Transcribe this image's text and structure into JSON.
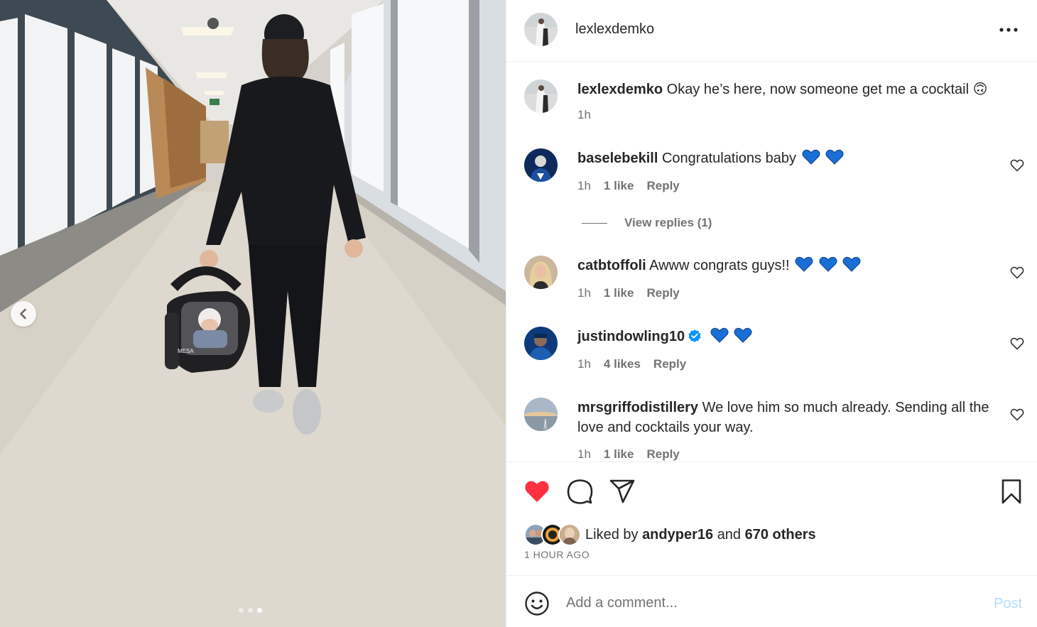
{
  "post": {
    "author": "lexlexdemko",
    "more_icon": "more-horizontal-icon"
  },
  "caption": {
    "username": "lexlexdemko",
    "text": "Okay he’s here, now someone get me a cocktail",
    "emoji": "🙃",
    "time": "1h"
  },
  "comments": [
    {
      "username": "baselebekill",
      "text": "Congratulations baby",
      "hearts": 2,
      "time": "1h",
      "likes": "1 like",
      "reply": "Reply",
      "verified": false
    },
    {
      "username": "catbtoffoli",
      "text": "Awww congrats guys!!",
      "hearts": 3,
      "time": "1h",
      "likes": "1 like",
      "reply": "Reply",
      "verified": false
    },
    {
      "username": "justindowling10",
      "text": "",
      "hearts": 2,
      "time": "1h",
      "likes": "4 likes",
      "reply": "Reply",
      "verified": true
    },
    {
      "username": "mrsgriffodistillery",
      "text": "We love him so much already. Sending all the love and cocktails your way.",
      "hearts": 0,
      "time": "1h",
      "likes": "1 like",
      "reply": "Reply",
      "verified": false
    }
  ],
  "view_replies": "View replies (1)",
  "likes": {
    "prefix": "Liked by",
    "user": "andyper16",
    "joiner": "and",
    "others": "670 others"
  },
  "time_ago": "1 HOUR AGO",
  "comment_box": {
    "placeholder": "Add a comment...",
    "post_label": "Post"
  },
  "colors": {
    "like_red": "#ff3040",
    "blue_heart": "#1a6fd6",
    "verified_blue": "#0095f6",
    "muted": "#737373"
  },
  "carousel": {
    "slides": 3,
    "active": 3
  }
}
